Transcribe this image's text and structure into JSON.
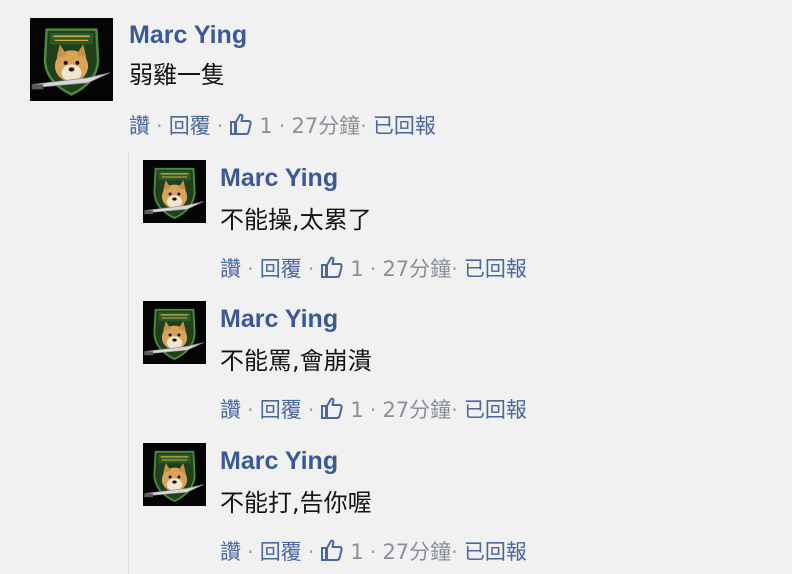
{
  "icons": {
    "avatar": "fox-hound-doge-emblem-icon",
    "like": "thumbs-up-icon"
  },
  "colors": {
    "name": "#3b5998",
    "link": "#4b67a1",
    "background": "#f1f1f1"
  },
  "comment": {
    "author": "Marc Ying",
    "text": "弱雞一隻",
    "actions": {
      "like": "讚",
      "reply": "回覆",
      "like_count": "1",
      "time": "27分鐘",
      "report": "已回報"
    }
  },
  "replies": [
    {
      "author": "Marc Ying",
      "text": "不能操,太累了",
      "actions": {
        "like": "讚",
        "reply": "回覆",
        "like_count": "1",
        "time": "27分鐘",
        "report": "已回報"
      }
    },
    {
      "author": "Marc Ying",
      "text": "不能罵,會崩潰",
      "actions": {
        "like": "讚",
        "reply": "回覆",
        "like_count": "1",
        "time": "27分鐘",
        "report": "已回報"
      }
    },
    {
      "author": "Marc Ying",
      "text": "不能打,告你喔",
      "actions": {
        "like": "讚",
        "reply": "回覆",
        "like_count": "1",
        "time": "27分鐘",
        "report": "已回報"
      }
    }
  ]
}
